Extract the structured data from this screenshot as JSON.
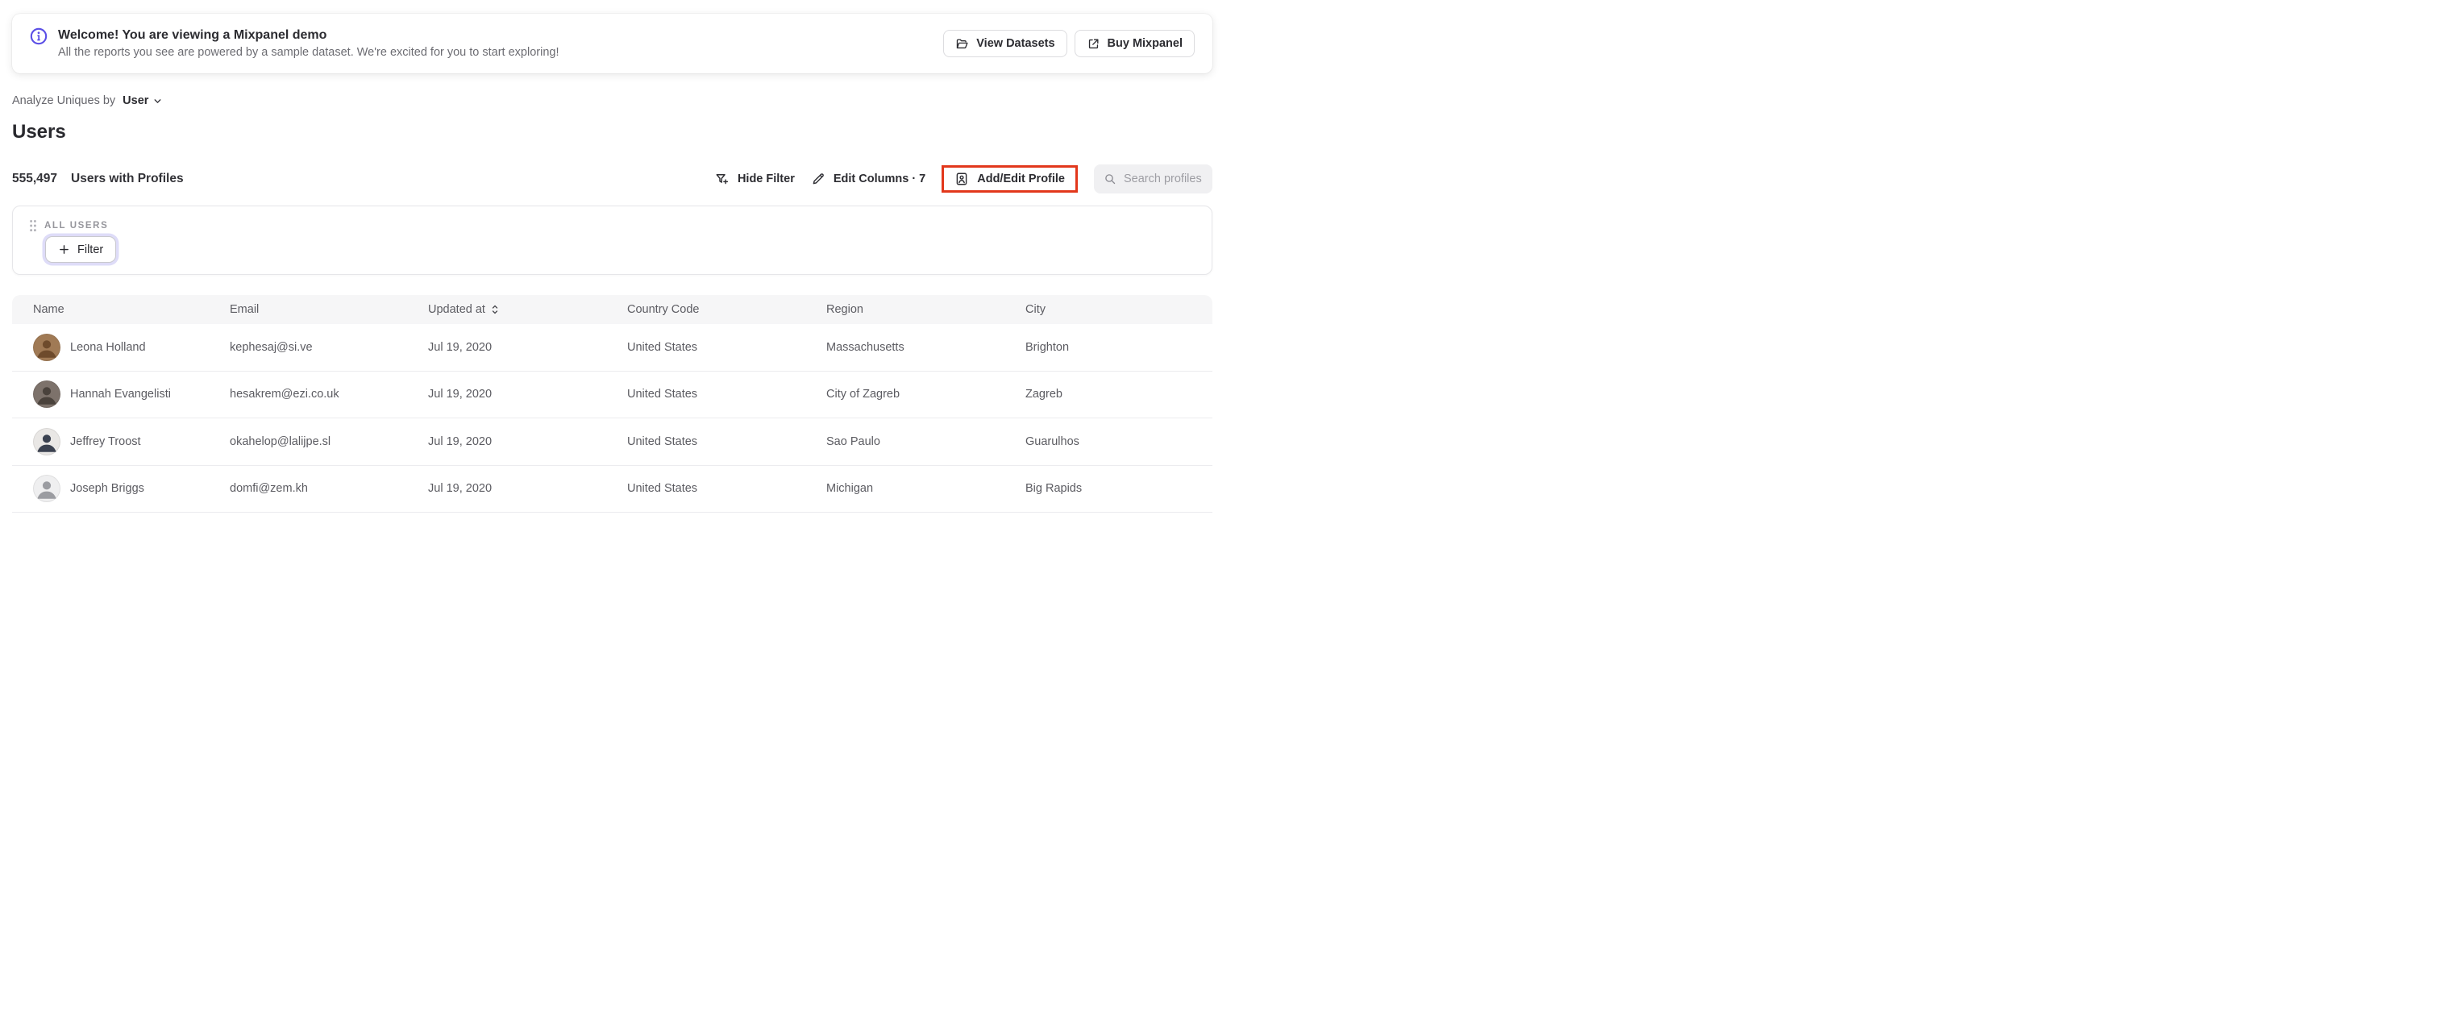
{
  "banner": {
    "title": "Welcome! You are viewing a Mixpanel demo",
    "subtitle": "All the reports you see are powered by a sample dataset. We're excited for you to start exploring!",
    "view_datasets_label": "View Datasets",
    "buy_mixpanel_label": "Buy Mixpanel"
  },
  "analyze": {
    "label": "Analyze Uniques by",
    "selected": "User"
  },
  "page_title": "Users",
  "stats": {
    "count": "555,497",
    "label": "Users with Profiles"
  },
  "toolbar": {
    "hide_filter_label": "Hide Filter",
    "edit_columns_label": "Edit Columns · 7",
    "add_edit_profile_label": "Add/Edit Profile",
    "search_placeholder": "Search profiles"
  },
  "filter_panel": {
    "group_label": "ALL USERS",
    "filter_button_label": "Filter"
  },
  "table": {
    "columns": [
      "Name",
      "Email",
      "Updated at",
      "Country Code",
      "Region",
      "City"
    ],
    "sorted_column": "Updated at",
    "rows": [
      {
        "name": "Leona Holland",
        "email": "kephesaj@si.ve",
        "updated_at": "Jul 19, 2020",
        "country": "United States",
        "region": "Massachusetts",
        "city": "Brighton",
        "avatar": {
          "bg": "#a07a55",
          "fg": "#6e4b2c"
        }
      },
      {
        "name": "Hannah Evangelisti",
        "email": "hesakrem@ezi.co.uk",
        "updated_at": "Jul 19, 2020",
        "country": "United States",
        "region": "City of Zagreb",
        "city": "Zagreb",
        "avatar": {
          "bg": "#7d726b",
          "fg": "#4a423c"
        }
      },
      {
        "name": "Jeffrey Troost",
        "email": "okahelop@lalijpe.sl",
        "updated_at": "Jul 19, 2020",
        "country": "United States",
        "region": "Sao Paulo",
        "city": "Guarulhos",
        "avatar": {
          "bg": "#e9e7e5",
          "fg": "#3a4150"
        }
      },
      {
        "name": "Joseph Briggs",
        "email": "domfi@zem.kh",
        "updated_at": "Jul 19, 2020",
        "country": "United States",
        "region": "Michigan",
        "city": "Big Rapids",
        "avatar": {
          "bg": "#efeff0",
          "fg": "#9b9ca1"
        }
      }
    ]
  },
  "colors": {
    "accent_purple": "#5b4fe6",
    "highlight_red": "#e2371b"
  }
}
